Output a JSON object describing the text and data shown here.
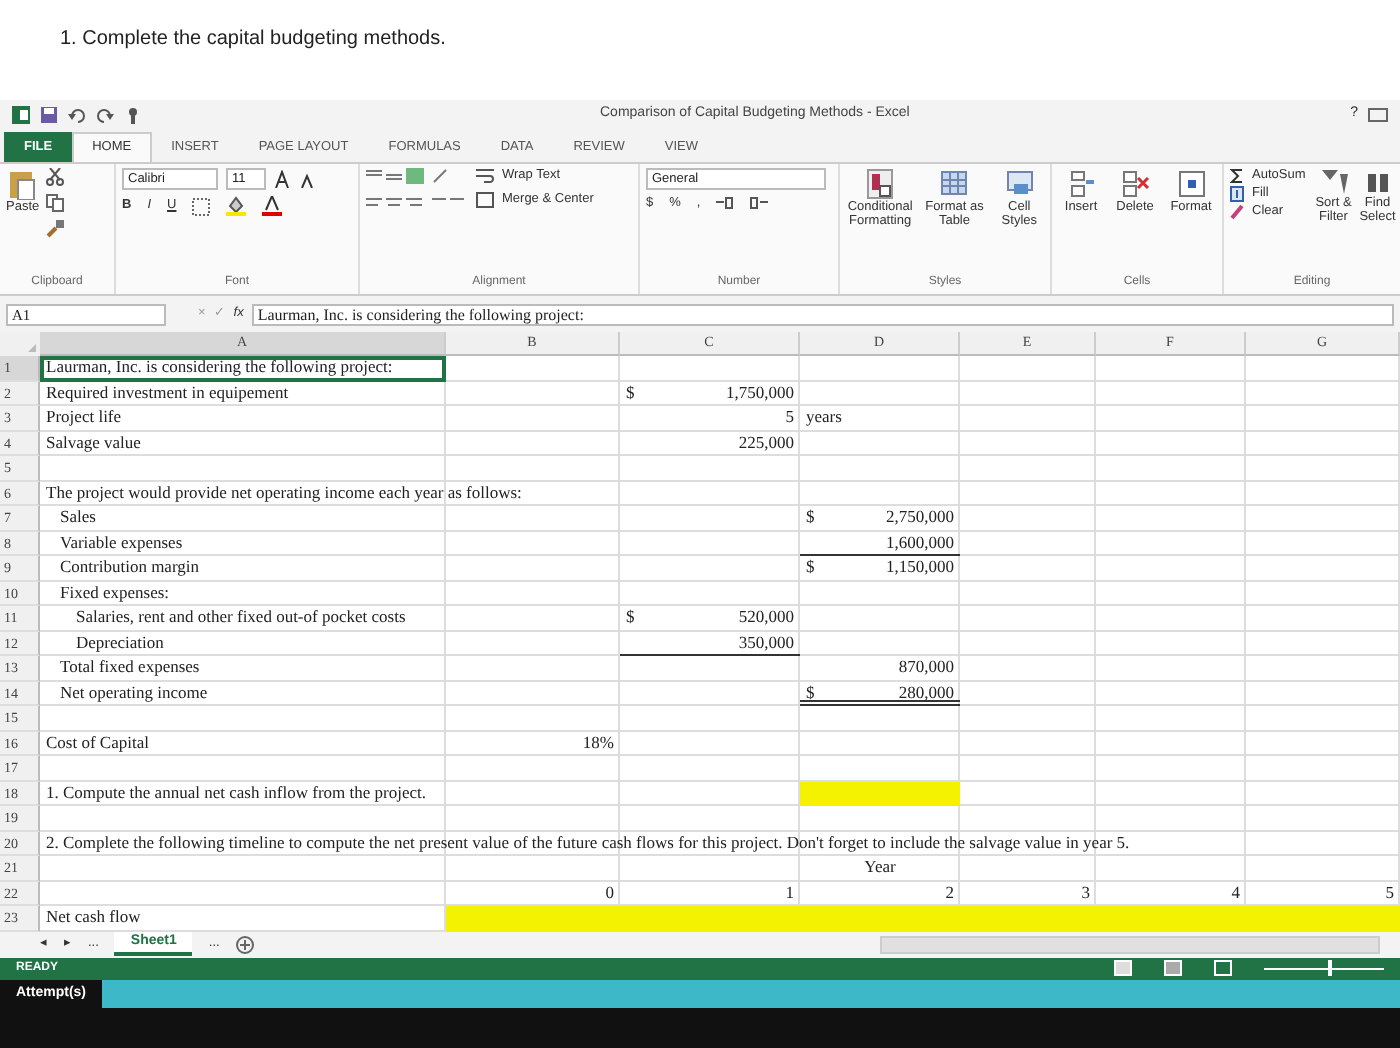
{
  "instruction": "1. Complete the capital budgeting methods.",
  "window": {
    "title": "Comparison of Capital Budgeting Methods - Excel",
    "help": "?"
  },
  "tabs": [
    {
      "label": "FILE",
      "kind": "file",
      "selected": false
    },
    {
      "label": "HOME",
      "kind": "tab",
      "selected": true
    },
    {
      "label": "INSERT",
      "kind": "tab",
      "selected": false
    },
    {
      "label": "PAGE LAYOUT",
      "kind": "tab",
      "selected": false
    },
    {
      "label": "FORMULAS",
      "kind": "tab",
      "selected": false
    },
    {
      "label": "DATA",
      "kind": "tab",
      "selected": false
    },
    {
      "label": "REVIEW",
      "kind": "tab",
      "selected": false
    },
    {
      "label": "VIEW",
      "kind": "tab",
      "selected": false
    }
  ],
  "ribbon": {
    "clipboard": {
      "label": "Clipboard",
      "paste": "Paste"
    },
    "font": {
      "label": "Font",
      "name": "Calibri",
      "size": "11",
      "bold": "B",
      "italic": "I",
      "underline": "U"
    },
    "alignment": {
      "label": "Alignment",
      "wrap": "Wrap Text",
      "merge": "Merge & Center"
    },
    "number": {
      "label": "Number",
      "format": "General",
      "currency": "$",
      "percent": "%",
      "comma": ","
    },
    "styles": {
      "label": "Styles",
      "conditional": "Conditional Formatting",
      "table": "Format as Table",
      "cell_styles": "Cell Styles"
    },
    "cells": {
      "label": "Cells",
      "insert": "Insert",
      "delete": "Delete",
      "format": "Format"
    },
    "editing": {
      "label": "Editing",
      "autosum": "AutoSum",
      "fill": "Fill",
      "clear": "Clear",
      "sort": "Sort & Filter",
      "find": "Find Select"
    }
  },
  "formula_bar": {
    "name_box": "A1",
    "cancel": "×",
    "enter": "✓",
    "fx": "fx",
    "formula": "Laurman, Inc. is considering the following project:"
  },
  "columns": [
    {
      "label": "A",
      "selected": true
    },
    {
      "label": "B",
      "selected": false
    },
    {
      "label": "C",
      "selected": false
    },
    {
      "label": "D",
      "selected": false
    },
    {
      "label": "E",
      "selected": false
    },
    {
      "label": "F",
      "selected": false
    },
    {
      "label": "G",
      "selected": false
    }
  ],
  "rows": [
    {
      "header": "1",
      "selected": true,
      "cells": {
        "A": {
          "kind": "text",
          "text": "Laurman, Inc. is considering the following project:",
          "active": true
        }
      }
    },
    {
      "header": "2",
      "selected": false,
      "cells": {
        "A": {
          "kind": "text",
          "text": "Required investment in equipement"
        },
        "C": {
          "kind": "number",
          "symbol": "$",
          "text": "1,750,000"
        }
      }
    },
    {
      "header": "3",
      "selected": false,
      "cells": {
        "A": {
          "kind": "text",
          "text": "Project life"
        },
        "C": {
          "kind": "number",
          "text": "5"
        },
        "D": {
          "kind": "text",
          "text": "years"
        }
      }
    },
    {
      "header": "4",
      "selected": false,
      "cells": {
        "A": {
          "kind": "text",
          "text": "Salvage value"
        },
        "C": {
          "kind": "number",
          "text": "225,000"
        }
      }
    },
    {
      "header": "5",
      "selected": false,
      "cells": {}
    },
    {
      "header": "6",
      "selected": false,
      "cells": {
        "A": {
          "kind": "text",
          "text": "The project would provide net operating income each year as follows:"
        }
      }
    },
    {
      "header": "7",
      "selected": false,
      "cells": {
        "A": {
          "kind": "item",
          "text": "Sales"
        },
        "D": {
          "kind": "number",
          "symbol": "$",
          "text": "2,750,000"
        }
      }
    },
    {
      "header": "8",
      "selected": false,
      "cells": {
        "A": {
          "kind": "item",
          "text": "Variable expenses"
        },
        "D": {
          "kind": "number",
          "text": "1,600,000",
          "underline": true
        }
      }
    },
    {
      "header": "9",
      "selected": false,
      "cells": {
        "A": {
          "kind": "item",
          "text": "Contribution margin"
        },
        "D": {
          "kind": "number",
          "symbol": "$",
          "text": "1,150,000"
        }
      }
    },
    {
      "header": "10",
      "selected": false,
      "cells": {
        "A": {
          "kind": "item",
          "text": "Fixed expenses:"
        }
      }
    },
    {
      "header": "11",
      "selected": false,
      "cells": {
        "A": {
          "kind": "subitem",
          "text": "Salaries, rent and other fixed out-of pocket costs"
        },
        "C": {
          "kind": "number",
          "symbol": "$",
          "text": "520,000"
        }
      }
    },
    {
      "header": "12",
      "selected": false,
      "cells": {
        "A": {
          "kind": "subitem",
          "text": "Depreciation"
        },
        "C": {
          "kind": "number",
          "text": "350,000",
          "underline": true
        }
      }
    },
    {
      "header": "13",
      "selected": false,
      "cells": {
        "A": {
          "kind": "item",
          "text": "Total fixed expenses"
        },
        "D": {
          "kind": "number",
          "text": "870,000"
        }
      }
    },
    {
      "header": "14",
      "selected": false,
      "cells": {
        "A": {
          "kind": "item",
          "text": "Net operating income"
        },
        "D": {
          "kind": "number",
          "symbol": "$",
          "text": "280,000",
          "double_underline": true
        }
      }
    },
    {
      "header": "15",
      "selected": false,
      "cells": {}
    },
    {
      "header": "16",
      "selected": false,
      "cells": {
        "A": {
          "kind": "text",
          "text": "Cost of Capital"
        },
        "B": {
          "kind": "number",
          "text": "18%"
        }
      }
    },
    {
      "header": "17",
      "selected": false,
      "cells": {}
    },
    {
      "header": "18",
      "selected": false,
      "cells": {
        "A": {
          "kind": "text",
          "text": "1. Compute the annual net cash inflow from the project."
        },
        "D": {
          "kind": "input"
        }
      }
    },
    {
      "header": "19",
      "selected": false,
      "cells": {}
    },
    {
      "header": "20",
      "selected": false,
      "cells": {
        "A": {
          "kind": "text",
          "text": "2.  Complete the following timeline to compute the net present value of the future cash flows for this project.  Don't forget to include the salvage value in year 5."
        }
      }
    },
    {
      "header": "21",
      "selected": false,
      "cells": {
        "D": {
          "kind": "center",
          "text": "Year"
        }
      }
    },
    {
      "header": "22",
      "selected": false,
      "cells": {
        "B": {
          "kind": "number",
          "text": "0"
        },
        "C": {
          "kind": "number",
          "text": "1"
        },
        "D": {
          "kind": "number",
          "text": "2"
        },
        "E": {
          "kind": "number",
          "text": "3"
        },
        "F": {
          "kind": "number",
          "text": "4"
        },
        "G": {
          "kind": "number",
          "text": "5"
        }
      }
    },
    {
      "header": "23",
      "selected": false,
      "cells": {
        "A": {
          "kind": "text",
          "text": "Net cash flow"
        },
        "B": {
          "kind": "input"
        },
        "C": {
          "kind": "input"
        },
        "D": {
          "kind": "input"
        },
        "E": {
          "kind": "input"
        },
        "F": {
          "kind": "input"
        },
        "G": {
          "kind": "input"
        }
      }
    }
  ],
  "sheet_tabs": {
    "first": "◂",
    "prev": "▸",
    "more": "...",
    "sheets": [
      {
        "label": "Sheet1",
        "selected": true
      }
    ],
    "more_after": "..."
  },
  "status_bar": {
    "text": "READY",
    "zoom": {
      "level": 0.55
    }
  },
  "attempts": "Attempt(s)"
}
